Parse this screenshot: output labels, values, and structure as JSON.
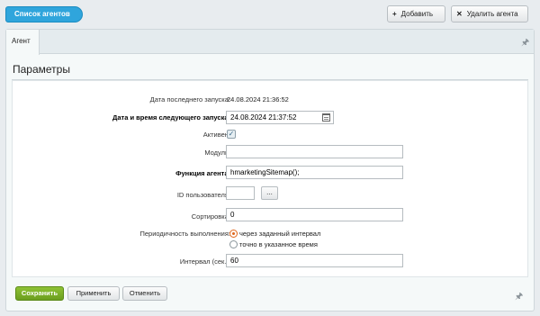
{
  "toolbar": {
    "list_button": "Список агентов",
    "add_button": "Добавить",
    "add_icon": "+",
    "delete_button": "Удалить агента",
    "delete_icon": "✕"
  },
  "tabs": [
    "Агент"
  ],
  "section_title": "Параметры",
  "form": {
    "last_run_label": "Дата последнего запуска:",
    "last_run_value": "24.08.2024 21:36:52",
    "next_run_label": "Дата и время следующего запуска:",
    "next_run_value": "24.08.2024 21:37:52",
    "active_label": "Активен:",
    "active_checked": true,
    "module_label": "Модуль:",
    "module_value": "",
    "function_label": "Функция агента:",
    "function_value": "hmarketingSitemap();",
    "user_id_label": "ID пользователя:",
    "user_id_value": "",
    "user_id_button": "...",
    "sort_label": "Сортировка:",
    "sort_value": "0",
    "periodicity_label": "Периодичность выполнения:",
    "periodicity_options": [
      "через заданный интервал",
      "точно в указанное время"
    ],
    "periodicity_selected": 0,
    "interval_label": "Интервал (сек.):",
    "interval_value": "60"
  },
  "footer": {
    "save_button": "Сохранить",
    "apply_button": "Применить",
    "cancel_button": "Отменить"
  },
  "icons": {
    "pin": "pin-icon",
    "calendar": "calendar-icon"
  },
  "colors": {
    "accent": "#2fa5dc",
    "save": "#7aaf26",
    "radio_active": "#e0661b"
  }
}
